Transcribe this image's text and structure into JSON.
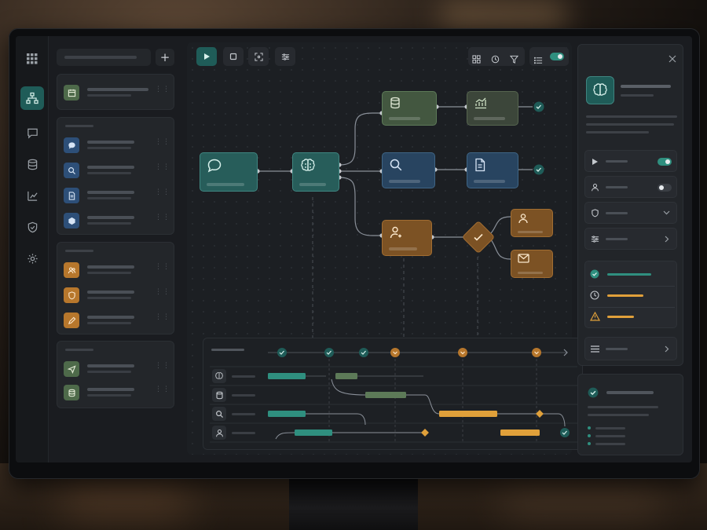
{
  "colors": {
    "accent_teal": "#2f8f7f",
    "orange": "#e0a03a",
    "green_node": "#435740",
    "blue_node": "#284460",
    "orange_node": "#7c5224"
  },
  "icons": {
    "nav": [
      "apps-grid-icon",
      "workflow-icon",
      "chat-icon",
      "database-icon",
      "analytics-icon",
      "shield-icon",
      "settings-icon"
    ],
    "library": [
      "calendar-icon",
      "chat-bubble-icon",
      "search-icon",
      "document-icon",
      "cube-icon",
      "users-icon",
      "shield-icon",
      "pencil-icon",
      "send-icon",
      "database-icon"
    ],
    "flow_nodes": [
      "chat-icon",
      "brain-icon",
      "database-icon",
      "search-icon",
      "user-icon",
      "chart-icon",
      "document-icon",
      "check-icon",
      "user-icon",
      "mail-icon"
    ],
    "timeline_rows": [
      "brain-icon",
      "database-icon",
      "search-icon",
      "user-icon"
    ]
  },
  "library": {
    "add_label": "+"
  },
  "timeline": {
    "milestone_status": [
      "done",
      "done",
      "done",
      "pending",
      "pending",
      "pending"
    ]
  },
  "properties": {
    "toggles": [
      {
        "icon": "play-icon",
        "state": "on"
      },
      {
        "icon": "user-icon",
        "state": "off"
      }
    ],
    "status_list": [
      {
        "icon": "check-circle-icon",
        "color": "#2f8f7f"
      },
      {
        "icon": "clock-icon",
        "color": "#e0a03a"
      },
      {
        "icon": "warning-icon",
        "color": "#e0a03a"
      }
    ]
  }
}
